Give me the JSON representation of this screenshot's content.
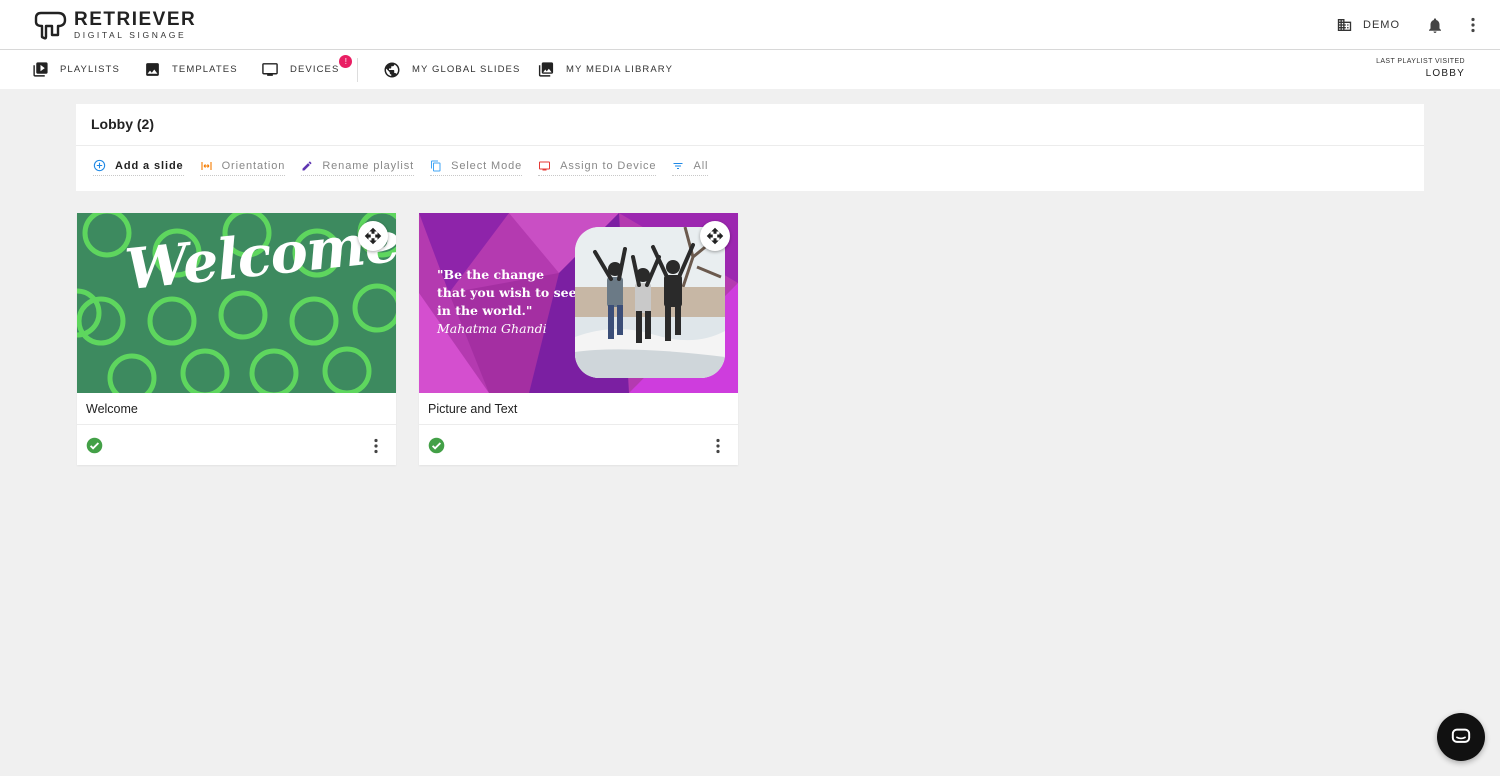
{
  "brand": {
    "title": "RETRIEVER",
    "subtitle": "DIGITAL SIGNAGE"
  },
  "header": {
    "org_label": "DEMO",
    "org_icon": "building-icon",
    "notifications_icon": "bell-icon",
    "menu_icon": "more-vertical-icon"
  },
  "nav": {
    "items": [
      {
        "label": "PLAYLISTS",
        "icon": "playlist-play-icon"
      },
      {
        "label": "TEMPLATES",
        "icon": "image-icon"
      },
      {
        "label": "DEVICES",
        "icon": "monitor-icon",
        "badge": "!"
      },
      {
        "label": "MY GLOBAL SLIDES",
        "icon": "globe-icon"
      },
      {
        "label": "MY MEDIA LIBRARY",
        "icon": "photo-library-icon"
      }
    ],
    "last_visited_label": "LAST PLAYLIST VISITED",
    "last_visited_value": "LOBBY"
  },
  "playlist": {
    "title": "Lobby (2)",
    "actions": [
      {
        "label": "Add a slide",
        "icon": "add-circle-icon",
        "color": "#1e88e5"
      },
      {
        "label": "Orientation",
        "icon": "orientation-icon",
        "color": "#f57c00"
      },
      {
        "label": "Rename playlist",
        "icon": "pencil-icon",
        "color": "#5e35b1"
      },
      {
        "label": "Select Mode",
        "icon": "copy-icon",
        "color": "#42a5f5"
      },
      {
        "label": "Assign to Device",
        "icon": "monitor-icon",
        "color": "#e53935"
      },
      {
        "label": "All",
        "icon": "filter-icon",
        "color": "#1e88e5"
      }
    ]
  },
  "slides": [
    {
      "name": "Welcome",
      "thumb_text": "Welcome",
      "status_icon": "check-circle-icon",
      "status_color": "#43a047",
      "bg_color": "#3d8a5f",
      "ring_color": "#5ed65e"
    },
    {
      "name": "Picture and Text",
      "quote": "\"Be the change that you wish to see in the world.\"",
      "author": "Mahatma Ghandi",
      "status_icon": "check-circle-icon",
      "status_color": "#43a047",
      "bg_color": "#b43ab0"
    }
  ],
  "chat": {
    "icon": "chat-bubble-icon"
  }
}
